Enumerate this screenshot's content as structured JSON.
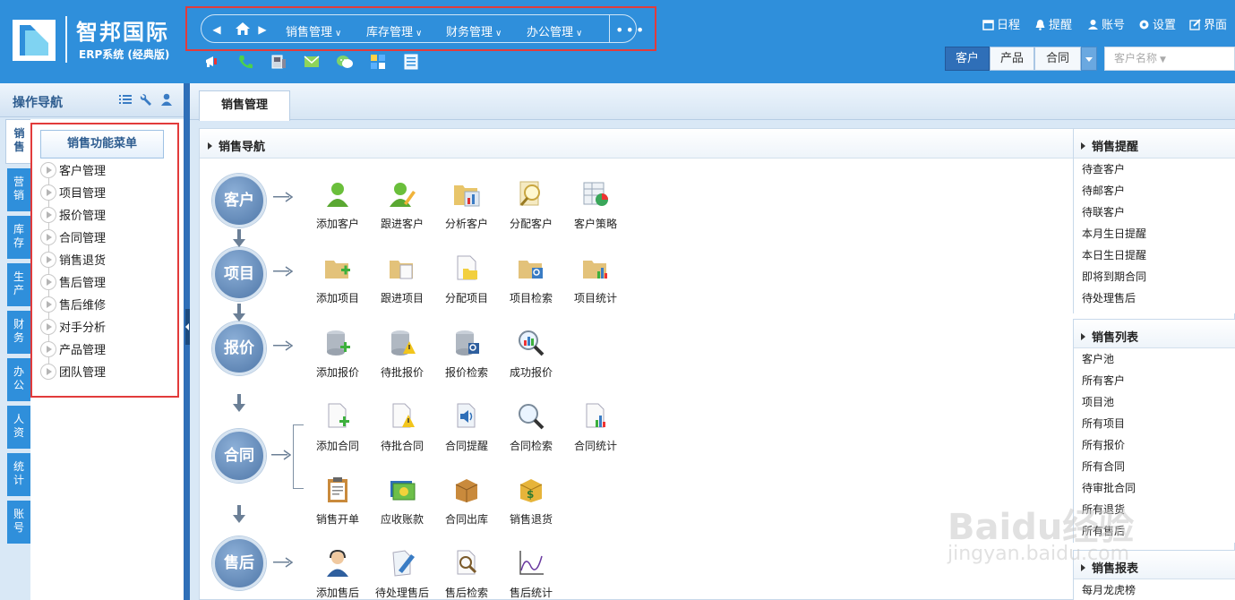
{
  "brand": {
    "title": "智邦国际",
    "subtitle": "ERP系统 (经典版)"
  },
  "topnav": {
    "menus": [
      "销售管理",
      "库存管理",
      "财务管理",
      "办公管理"
    ],
    "more": "•••"
  },
  "quick_icons": [
    "megaphone-icon",
    "phone-icon",
    "fax-icon",
    "mail-icon",
    "wechat-icon",
    "grid-icon",
    "notes-icon"
  ],
  "top_links": [
    "日程",
    "提醒",
    "账号",
    "设置",
    "界面"
  ],
  "search": {
    "segments": [
      "客户",
      "产品",
      "合同"
    ],
    "active": "客户",
    "placeholder": "客户名称"
  },
  "left_panel": {
    "title": "操作导航",
    "vtabs": [
      [
        "销",
        "售"
      ],
      [
        "营",
        "销"
      ],
      [
        "库",
        "存"
      ],
      [
        "生",
        "产"
      ],
      [
        "财",
        "务"
      ],
      [
        "办",
        "公"
      ],
      [
        "人",
        "资"
      ],
      [
        "统",
        "计"
      ],
      [
        "账",
        "号"
      ]
    ],
    "menu_title": "销售功能菜单",
    "menu_items": [
      "客户管理",
      "项目管理",
      "报价管理",
      "合同管理",
      "销售退货",
      "售后管理",
      "售后维修",
      "对手分析",
      "产品管理",
      "团队管理"
    ]
  },
  "main": {
    "tab": "销售管理",
    "section_title": "销售导航",
    "stages": [
      {
        "label": "客户",
        "funcs": [
          "添加客户",
          "跟进客户",
          "分析客户",
          "分配客户",
          "客户策略"
        ]
      },
      {
        "label": "项目",
        "funcs": [
          "添加项目",
          "跟进项目",
          "分配项目",
          "项目检索",
          "项目统计"
        ]
      },
      {
        "label": "报价",
        "funcs": [
          "添加报价",
          "待批报价",
          "报价检索",
          "成功报价"
        ]
      },
      {
        "label": "合同",
        "funcs": [
          "添加合同",
          "待批合同",
          "合同提醒",
          "合同检索",
          "合同统计"
        ],
        "funcs2": [
          "销售开单",
          "应收账款",
          "合同出库",
          "销售退货"
        ]
      },
      {
        "label": "售后",
        "funcs": [
          "添加售后",
          "待处理售后",
          "售后检索",
          "售后统计"
        ]
      }
    ]
  },
  "right_panels": [
    {
      "title": "销售提醒",
      "items": [
        "待查客户",
        "待邮客户",
        "待联客户",
        "本月生日提醒",
        "本日生日提醒",
        "即将到期合同",
        "待处理售后"
      ]
    },
    {
      "title": "销售列表",
      "items": [
        "客户池",
        "所有客户",
        "项目池",
        "所有项目",
        "所有报价",
        "所有合同",
        "待审批合同",
        "所有退货",
        "所有售后"
      ]
    },
    {
      "title": "销售报表",
      "items": [
        "每月龙虎榜"
      ]
    }
  ],
  "watermark": {
    "main": "Baidu经验",
    "sub": "jingyan.baidu.com"
  },
  "colors": {
    "header_blue": "#2f8fdb",
    "highlight_red": "#e23b3b",
    "stage_blue": "#5a80b0"
  }
}
